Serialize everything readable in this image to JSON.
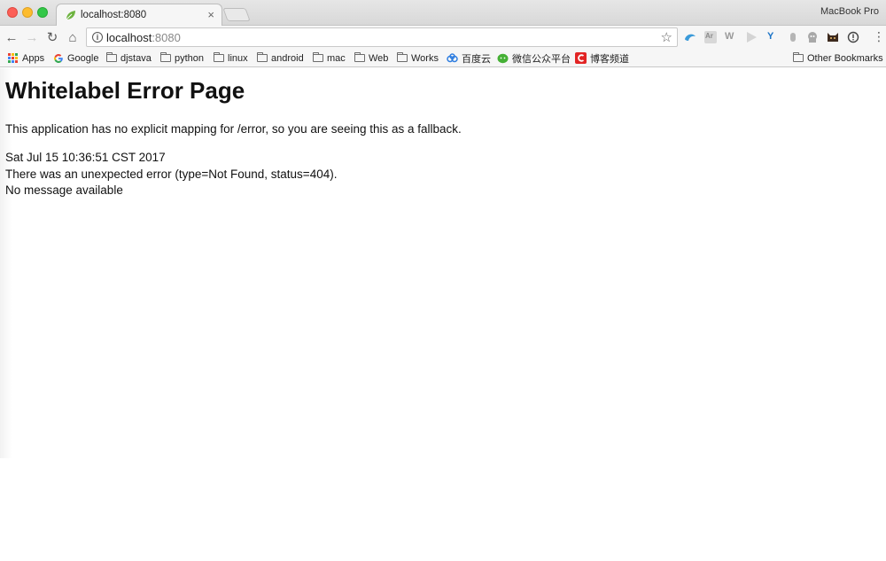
{
  "window": {
    "machine_label": "MacBook Pro"
  },
  "tab": {
    "title": "localhost:8080",
    "close_glyph": "×",
    "favicon": "spring-leaf-icon",
    "favicon_color": "#6db33f"
  },
  "toolbar": {
    "back_glyph": "←",
    "forward_glyph": "→",
    "reload_glyph": "↻",
    "home_glyph": "⌂",
    "url_host": "localhost",
    "url_port": ":8080",
    "info_glyph": "i",
    "star_glyph": "☆",
    "menu_glyph": "⋮",
    "extensions": [
      {
        "name": "ext-swirl-icon",
        "color": "#3a9ad9"
      },
      {
        "name": "ext-ar-icon",
        "color": "#bdbdbd",
        "text": "Ar"
      },
      {
        "name": "ext-w-icon",
        "color": "#9a9a9a",
        "text": "W"
      },
      {
        "name": "ext-play-icon",
        "color": "#cfcfcf"
      },
      {
        "name": "ext-y-icon",
        "color": "#1a73c7",
        "text": "Y"
      },
      {
        "name": "ext-hand-icon",
        "color": "#b5b5b5"
      },
      {
        "name": "ext-ghost-icon",
        "color": "#a0a0a0"
      },
      {
        "name": "ext-cat-icon",
        "color": "#3d2a1e"
      },
      {
        "name": "ext-alert-icon",
        "color": "#444444"
      }
    ]
  },
  "bookmarks": {
    "apps": "Apps",
    "google": "Google",
    "items": [
      "djstava",
      "python",
      "linux",
      "android",
      "mac",
      "Web",
      "Works"
    ],
    "baidu": "百度云",
    "wechat": "微信公众平台",
    "blog": "博客频道",
    "other": "Other Bookmarks"
  },
  "page": {
    "title": "Whitelabel Error Page",
    "description": "This application has no explicit mapping for /error, so you are seeing this as a fallback.",
    "timestamp": "Sat Jul 15 10:36:51 CST 2017",
    "error_line": "There was an unexpected error (type=Not Found, status=404).",
    "message": "No message available"
  }
}
